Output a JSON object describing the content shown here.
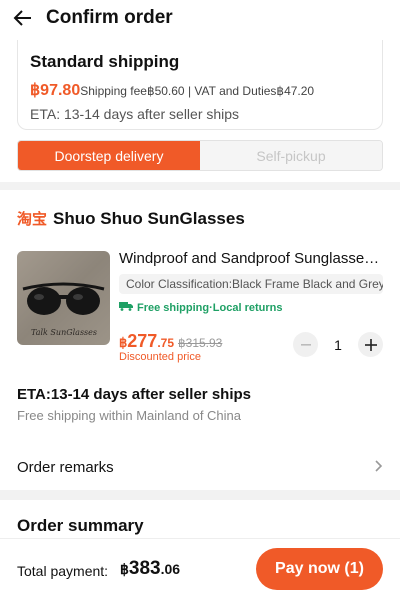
{
  "header": {
    "title": "Confirm order"
  },
  "shipping": {
    "title": "Standard shipping",
    "price": "฿97.80",
    "fee_detail": "Shipping fee฿50.60 | VAT and Duties฿47.20",
    "eta": "ETA: 13-14 days after seller ships"
  },
  "delivery_toggle": {
    "active": "Doorstep delivery",
    "inactive": "Self-pickup"
  },
  "shop": {
    "logo_text": "淘宝",
    "name": "Shuo Shuo SunGlasses"
  },
  "product": {
    "image_caption": "Talk SunGlasses",
    "name": "Windproof and Sandproof Sunglasses for Men",
    "variant": "Color Classification:Black Frame Black and Grey Lens",
    "free_shipping": "Free shipping·Local returns",
    "price_currency": "฿",
    "price_int": "277",
    "price_dec": ".75",
    "original_price": "฿315.93",
    "discount_label": "Discounted price",
    "quantity": "1"
  },
  "eta_section": {
    "title": "ETA:13-14 days after seller ships",
    "subtitle": "Free shipping within Mainland of China"
  },
  "remarks": {
    "label": "Order remarks"
  },
  "summary": {
    "title": "Order summary"
  },
  "footer": {
    "total_label": "Total payment:",
    "total_currency": "฿",
    "total_int": "383",
    "total_dec": ".06",
    "pay_button": "Pay now (1)"
  },
  "colors": {
    "accent": "#f05a28",
    "green": "#1fa065"
  },
  "icons": {
    "back": "arrow-left-icon",
    "truck": "truck-icon",
    "chevron": "chevron-right-icon"
  }
}
